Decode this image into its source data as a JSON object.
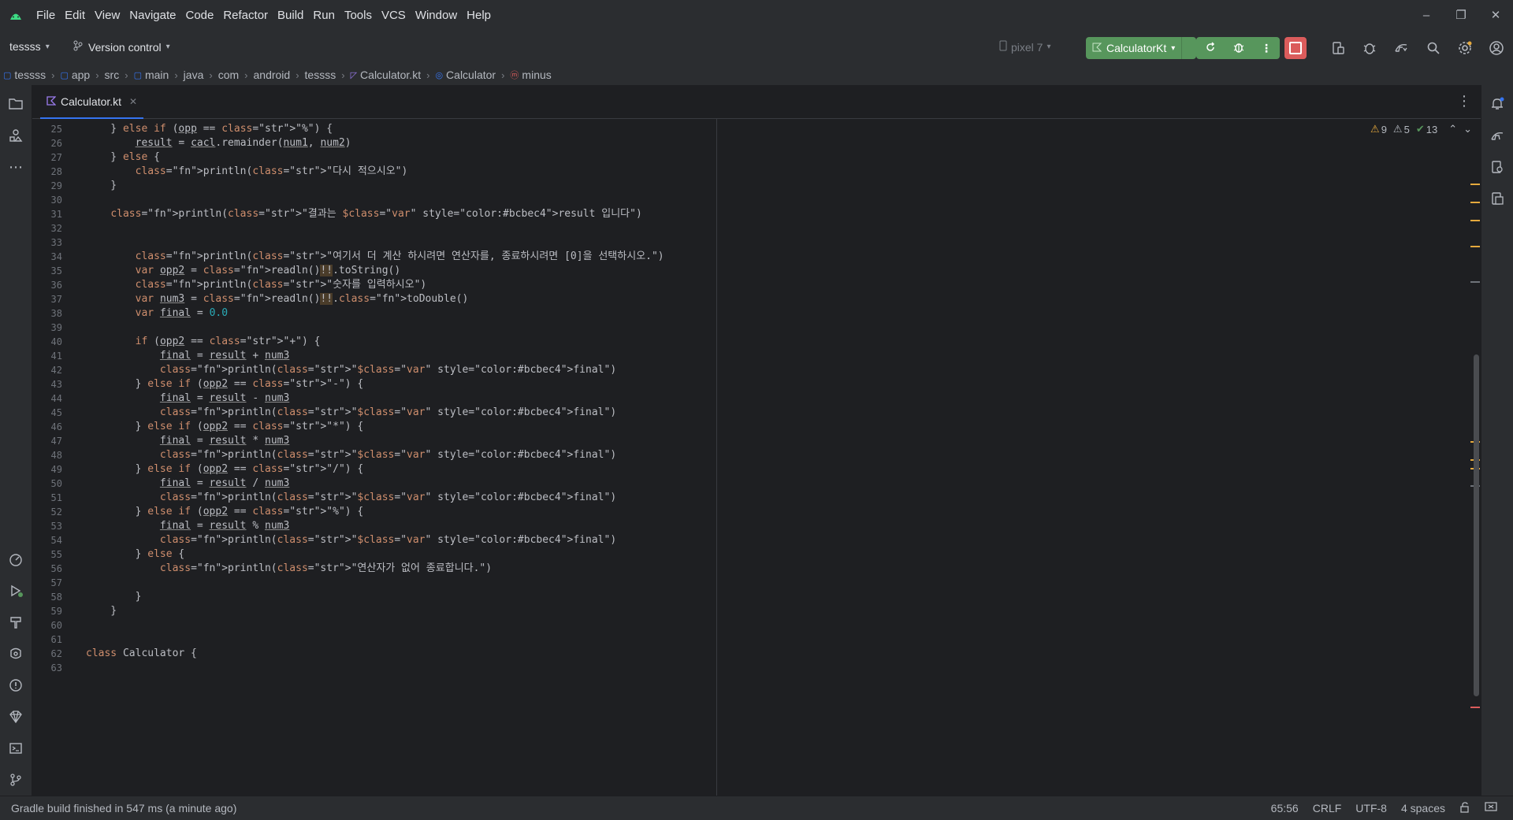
{
  "menu": [
    "File",
    "Edit",
    "View",
    "Navigate",
    "Code",
    "Refactor",
    "Build",
    "Run",
    "Tools",
    "VCS",
    "Window",
    "Help"
  ],
  "toolbar": {
    "project": "tessss",
    "vcs": "Version control",
    "device": "pixel 7",
    "run_config": "CalculatorKt"
  },
  "breadcrumbs": [
    "tessss",
    "app",
    "src",
    "main",
    "java",
    "com",
    "android",
    "tessss",
    "Calculator.kt",
    "Calculator",
    "minus"
  ],
  "tab": {
    "label": "Calculator.kt"
  },
  "inspections": {
    "warnings": "9",
    "weak_warnings": "5",
    "ok": "13"
  },
  "code_lines": [
    {
      "n": "25",
      "text": "    } else if (opp == \"%\") {"
    },
    {
      "n": "26",
      "text": "        result = cacl.remainder(num1, num2)"
    },
    {
      "n": "27",
      "text": "    } else {"
    },
    {
      "n": "28",
      "text": "        println(\"다시 적으시오\")"
    },
    {
      "n": "29",
      "text": "    }"
    },
    {
      "n": "30",
      "text": ""
    },
    {
      "n": "31",
      "text": "    println(\"결과는 $result 입니다\")"
    },
    {
      "n": "32",
      "text": ""
    },
    {
      "n": "33",
      "text": ""
    },
    {
      "n": "34",
      "text": "        println(\"여기서 더 계산 하시려면 연산자를, 종료하시려면 [0]을 선택하시오.\")"
    },
    {
      "n": "35",
      "text": "        var opp2 = readln()!!.toString()"
    },
    {
      "n": "36",
      "text": "        println(\"숫자를 입력하시오\")"
    },
    {
      "n": "37",
      "text": "        var num3 = readln()!!.toDouble()"
    },
    {
      "n": "38",
      "text": "        var final = 0.0"
    },
    {
      "n": "39",
      "text": ""
    },
    {
      "n": "40",
      "text": "        if (opp2 == \"+\") {"
    },
    {
      "n": "41",
      "text": "            final = result + num3"
    },
    {
      "n": "42",
      "text": "            println(\"$final\")"
    },
    {
      "n": "43",
      "text": "        } else if (opp2 == \"-\") {"
    },
    {
      "n": "44",
      "text": "            final = result - num3"
    },
    {
      "n": "45",
      "text": "            println(\"$final\")"
    },
    {
      "n": "46",
      "text": "        } else if (opp2 == \"*\") {"
    },
    {
      "n": "47",
      "text": "            final = result * num3"
    },
    {
      "n": "48",
      "text": "            println(\"$final\")"
    },
    {
      "n": "49",
      "text": "        } else if (opp2 == \"/\") {"
    },
    {
      "n": "50",
      "text": "            final = result / num3"
    },
    {
      "n": "51",
      "text": "            println(\"$final\")"
    },
    {
      "n": "52",
      "text": "        } else if (opp2 == \"%\") {"
    },
    {
      "n": "53",
      "text": "            final = result % num3"
    },
    {
      "n": "54",
      "text": "            println(\"$final\")"
    },
    {
      "n": "55",
      "text": "        } else {"
    },
    {
      "n": "56",
      "text": "            println(\"연산자가 없어 종료합니다.\")"
    },
    {
      "n": "57",
      "text": ""
    },
    {
      "n": "58",
      "text": "        }"
    },
    {
      "n": "59",
      "text": "    }"
    },
    {
      "n": "60",
      "text": ""
    },
    {
      "n": "61",
      "text": ""
    },
    {
      "n": "62",
      "text": "class Calculator {"
    },
    {
      "n": "63",
      "text": ""
    }
  ],
  "status": {
    "message": "Gradle build finished in 547 ms (a minute ago)",
    "position": "65:56",
    "line_sep": "CRLF",
    "encoding": "UTF-8",
    "indent": "4 spaces"
  },
  "colors": {
    "accent": "#3574f0",
    "run": "#57965c",
    "stop": "#db5c5c",
    "warning": "#e5a93d"
  }
}
